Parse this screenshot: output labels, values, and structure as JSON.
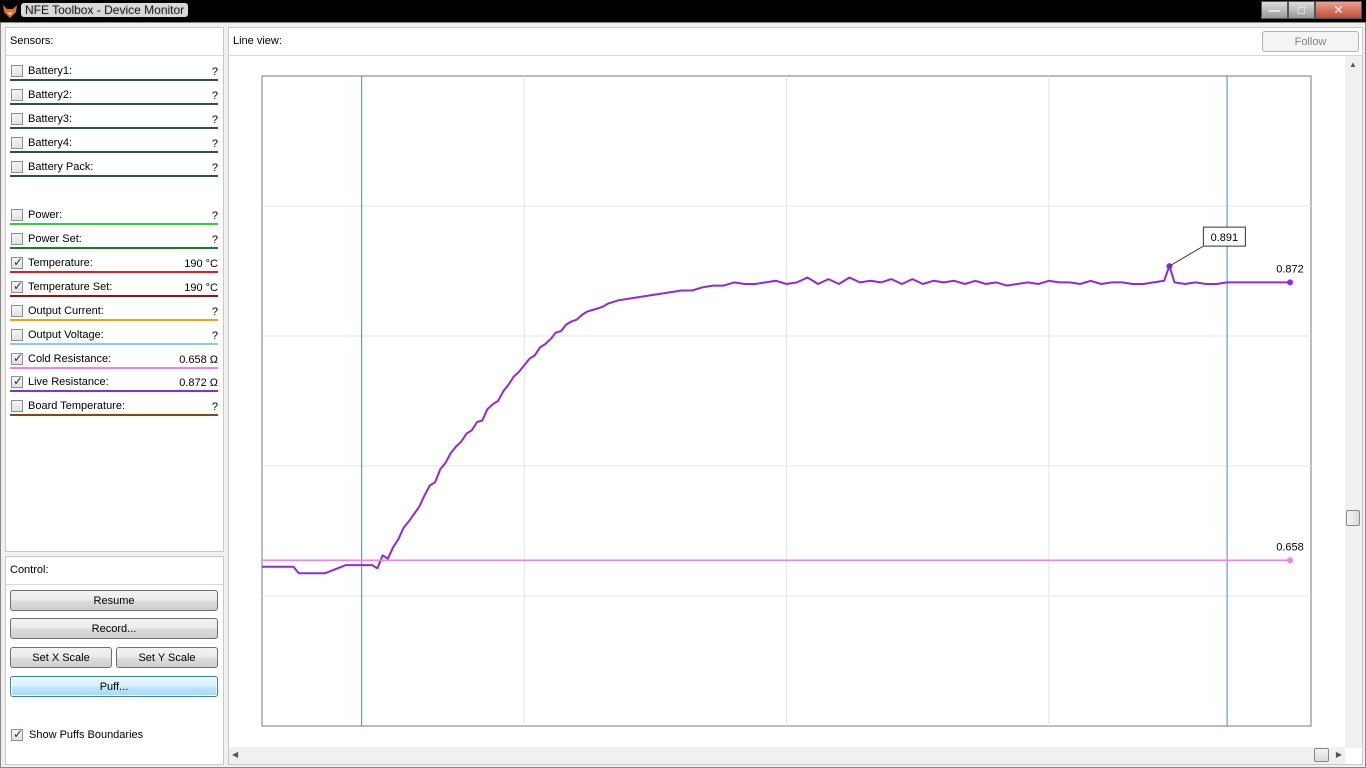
{
  "window": {
    "title": "NFE Toolbox - Device Monitor",
    "controls": {
      "minimize": "—",
      "maximize": "□",
      "close": "✕"
    }
  },
  "sensors": {
    "title": "Sensors:",
    "items": [
      {
        "label": "Battery1:",
        "value": "?",
        "checked": false,
        "color": "#2f4f4f"
      },
      {
        "label": "Battery2:",
        "value": "?",
        "checked": false,
        "color": "#2f4f4f"
      },
      {
        "label": "Battery3:",
        "value": "?",
        "checked": false,
        "color": "#2f4f4f"
      },
      {
        "label": "Battery4:",
        "value": "?",
        "checked": false,
        "color": "#2f4f4f"
      },
      {
        "label": "Battery Pack:",
        "value": "?",
        "checked": false,
        "color": "#2f4f4f"
      },
      {
        "label": "Power:",
        "value": "?",
        "checked": false,
        "color": "#3cc83c"
      },
      {
        "label": "Power Set:",
        "value": "?",
        "checked": false,
        "color": "#1e7a2e"
      },
      {
        "label": "Temperature:",
        "value": "190 °C",
        "checked": true,
        "color": "#e02020"
      },
      {
        "label": "Temperature Set:",
        "value": "190 °C",
        "checked": true,
        "color": "#8b1a1a"
      },
      {
        "label": "Output Current:",
        "value": "?",
        "checked": false,
        "color": "#f0a020"
      },
      {
        "label": "Output Voltage:",
        "value": "?",
        "checked": false,
        "color": "#8ecae6"
      },
      {
        "label": "Cold Resistance:",
        "value": "0.658 Ω",
        "checked": true,
        "color": "#ee82ee"
      },
      {
        "label": "Live Resistance:",
        "value": "0.872 Ω",
        "checked": true,
        "color": "#8a2be2"
      },
      {
        "label": "Board Temperature:",
        "value": "?",
        "checked": false,
        "color": "#8b4513"
      }
    ]
  },
  "control": {
    "title": "Control:",
    "resume": "Resume",
    "record": "Record...",
    "set_x_scale": "Set X Scale",
    "set_y_scale": "Set Y Scale",
    "puff": "Puff...",
    "show_puffs": "Show Puffs Boundaries",
    "show_puffs_checked": true
  },
  "lineview": {
    "title": "Line view:",
    "follow": "Follow"
  },
  "chart_data": {
    "type": "line",
    "title": "",
    "xlabel": "",
    "ylabel": "",
    "grid": true,
    "puff_boundaries_x": [
      19,
      184
    ],
    "x_range": [
      0,
      200
    ],
    "y_range": [
      0.55,
      0.95
    ],
    "series": [
      {
        "name": "Live Resistance",
        "color": "#8a2be2",
        "x": [
          0,
          3,
          6,
          7,
          10,
          12,
          16,
          17,
          21,
          22,
          23,
          24,
          25,
          26,
          27,
          28,
          30,
          31,
          32,
          33,
          34,
          35,
          36,
          37,
          38,
          39,
          40,
          41,
          42,
          43,
          44,
          45,
          46,
          47,
          48,
          49,
          50,
          51,
          52,
          53,
          54,
          55,
          56,
          57,
          58,
          59,
          60,
          61,
          62,
          63,
          64,
          65,
          66,
          67,
          68,
          70,
          72,
          74,
          76,
          78,
          80,
          82,
          84,
          86,
          88,
          90,
          92,
          94,
          96,
          98,
          100,
          102,
          104,
          106,
          108,
          110,
          112,
          114,
          116,
          118,
          120,
          122,
          124,
          126,
          128,
          130,
          132,
          134,
          136,
          138,
          140,
          142,
          144,
          146,
          148,
          150,
          152,
          154,
          156,
          158,
          160,
          162,
          164,
          166,
          168,
          170,
          172,
          173,
          174,
          176,
          178,
          180,
          182,
          184,
          186,
          190,
          194,
          196
        ],
        "values": [
          0.648,
          0.648,
          0.648,
          0.644,
          0.644,
          0.644,
          0.649,
          0.649,
          0.649,
          0.647,
          0.655,
          0.653,
          0.66,
          0.665,
          0.672,
          0.676,
          0.685,
          0.692,
          0.698,
          0.7,
          0.708,
          0.712,
          0.718,
          0.722,
          0.725,
          0.73,
          0.732,
          0.737,
          0.738,
          0.745,
          0.748,
          0.75,
          0.756,
          0.76,
          0.765,
          0.768,
          0.772,
          0.776,
          0.778,
          0.783,
          0.785,
          0.788,
          0.792,
          0.793,
          0.797,
          0.799,
          0.8,
          0.803,
          0.805,
          0.806,
          0.807,
          0.808,
          0.81,
          0.811,
          0.812,
          0.813,
          0.814,
          0.815,
          0.816,
          0.817,
          0.818,
          0.818,
          0.82,
          0.821,
          0.821,
          0.823,
          0.822,
          0.822,
          0.823,
          0.824,
          0.822,
          0.823,
          0.826,
          0.822,
          0.825,
          0.822,
          0.826,
          0.823,
          0.824,
          0.823,
          0.825,
          0.822,
          0.825,
          0.822,
          0.824,
          0.823,
          0.824,
          0.822,
          0.824,
          0.822,
          0.823,
          0.821,
          0.822,
          0.823,
          0.822,
          0.824,
          0.823,
          0.823,
          0.822,
          0.824,
          0.822,
          0.823,
          0.823,
          0.822,
          0.822,
          0.823,
          0.824,
          0.833,
          0.823,
          0.822,
          0.823,
          0.822,
          0.822,
          0.823,
          0.823,
          0.823,
          0.823,
          0.823
        ]
      },
      {
        "name": "Cold Resistance",
        "color": "#ee82ee",
        "x": [
          0,
          196
        ],
        "values": [
          0.652,
          0.652
        ]
      }
    ],
    "annotations": [
      {
        "text": "0.891",
        "series": "Live Resistance",
        "x": 173
      },
      {
        "text": "0.872",
        "series": "Live Resistance",
        "x": 196
      },
      {
        "text": "0.658",
        "series": "Cold Resistance",
        "x": 196
      }
    ]
  }
}
